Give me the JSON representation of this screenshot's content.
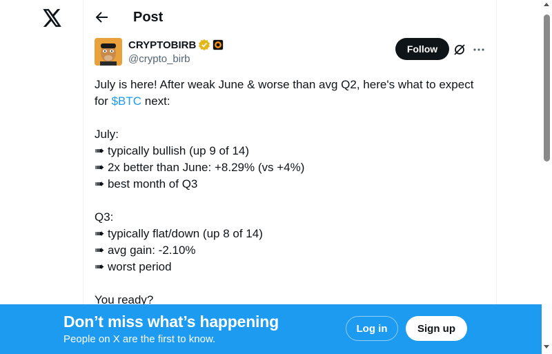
{
  "nav": {
    "logo_icon": "x-logo-icon"
  },
  "header": {
    "title": "Post",
    "back_icon": "arrow-left-icon"
  },
  "author": {
    "display_name": "CRYPTOBIRB",
    "handle": "@crypto_birb",
    "verified_icon": "gold-verified-badge-icon",
    "affiliate_icon": "affiliate-badge-icon",
    "follow_label": "Follow",
    "grok_icon": "grok-icon",
    "more_icon": "more-horizontal-icon"
  },
  "post": {
    "line1": "July is here! After weak June & worse than avg Q2, here's what to expect",
    "line2_prefix": "for ",
    "cashtag": "$BTC",
    "line2_suffix": " next:",
    "july_header": "July:",
    "july_items": [
      "➠ typically bullish (up 9 of 14)",
      "➠ 2x better than June: +8.29% (vs +4%)",
      "➠ best month of Q3"
    ],
    "q3_header": "Q3:",
    "q3_items": [
      "➠ typically flat/down (up 8 of 14)",
      "➠ avg gain: -2.10%",
      "➠ worst period"
    ],
    "closing": "You ready?"
  },
  "signup_banner": {
    "title": "Don’t miss what’s happening",
    "subtitle": "People on X are the first to know.",
    "login_label": "Log in",
    "signup_label": "Sign up"
  },
  "colors": {
    "accent": "#1d9bf0",
    "text": "#0f1419",
    "muted": "#536471"
  }
}
